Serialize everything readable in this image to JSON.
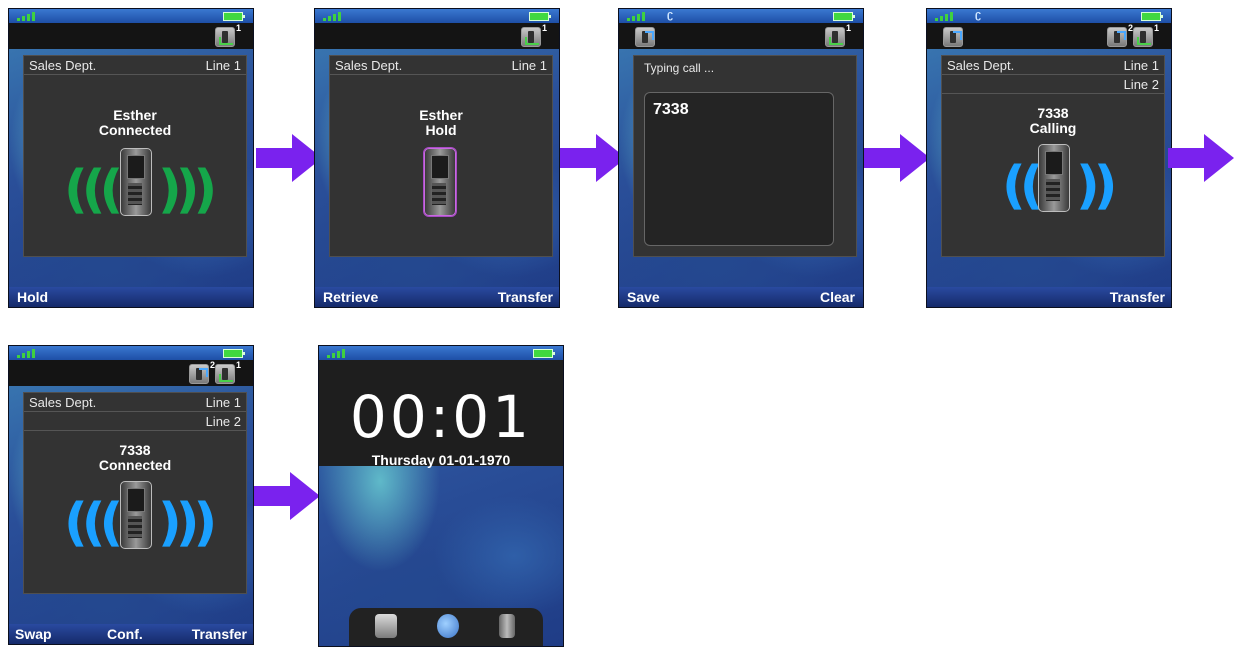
{
  "screens": {
    "s1": {
      "line_label": "Sales Dept.",
      "line_name": "Line 1",
      "caller": "Esther",
      "state": "Connected",
      "softkey_left": "Hold",
      "badge": "1"
    },
    "s2": {
      "line_label": "Sales Dept.",
      "line_name": "Line 1",
      "caller": "Esther",
      "state": "Hold",
      "softkey_left": "Retrieve",
      "softkey_right": "Transfer",
      "badge": "1"
    },
    "s3": {
      "title": "Typing call ...",
      "value": "7338",
      "softkey_left": "Save",
      "softkey_right": "Clear",
      "badge": "1"
    },
    "s4": {
      "line_label": "Sales Dept.",
      "line_name": "Line 1",
      "line2_name": "Line 2",
      "caller": "7338",
      "state": "Calling",
      "softkey_right": "Transfer",
      "badge_a": "2",
      "badge_b": "1"
    },
    "s5": {
      "line_label": "Sales Dept.",
      "line_name": "Line 1",
      "line2_name": "Line 2",
      "caller": "7338",
      "state": "Connected",
      "softkey_left": "Swap",
      "softkey_middle": "Conf.",
      "softkey_right": "Transfer",
      "badge_a": "2",
      "badge_b": "1"
    },
    "s6": {
      "time": "00:01",
      "date": "Thursday 01-01-1970"
    }
  },
  "colors": {
    "arrow": "#7a22ee",
    "wave_green": "#15a64a",
    "wave_blue": "#1aa0ff"
  }
}
